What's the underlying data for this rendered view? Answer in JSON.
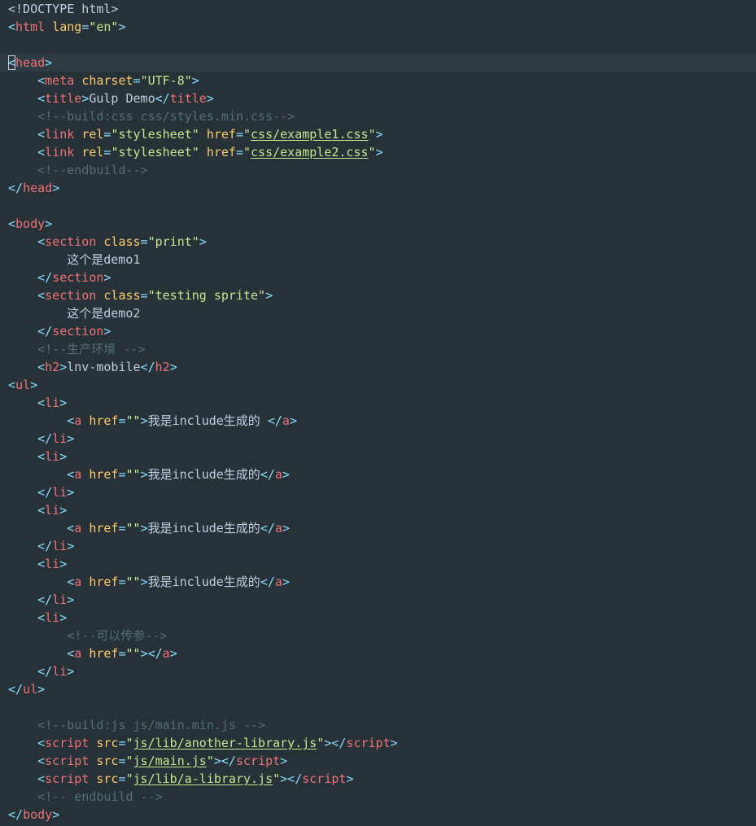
{
  "colors": {
    "background": "#263238",
    "current_line": "#2d3b42",
    "punct": "#89ddff",
    "plain": "#c3cee3",
    "tag": "#f07178",
    "attr": "#ffcb6b",
    "string": "#c3e88d",
    "comment": "#546e7a"
  },
  "editor": {
    "current_line_index": 3,
    "cursor_token": "<",
    "lines": [
      [
        [
          "plain",
          "<!DOCTYPE html>"
        ]
      ],
      [
        [
          "punct",
          "<"
        ],
        [
          "tag",
          "html"
        ],
        [
          "plain",
          " "
        ],
        [
          "attr",
          "lang"
        ],
        [
          "punct",
          "="
        ],
        [
          "str",
          "\"en\""
        ],
        [
          "punct",
          ">"
        ]
      ],
      [],
      [
        [
          "punct",
          "<"
        ],
        [
          "tag",
          "head"
        ],
        [
          "punct",
          ">"
        ]
      ],
      [
        [
          "plain",
          "    "
        ],
        [
          "punct",
          "<"
        ],
        [
          "tag",
          "meta"
        ],
        [
          "plain",
          " "
        ],
        [
          "attr",
          "charset"
        ],
        [
          "punct",
          "="
        ],
        [
          "str",
          "\"UTF-8\""
        ],
        [
          "punct",
          ">"
        ]
      ],
      [
        [
          "plain",
          "    "
        ],
        [
          "punct",
          "<"
        ],
        [
          "tag",
          "title"
        ],
        [
          "punct",
          ">"
        ],
        [
          "text",
          "Gulp Demo"
        ],
        [
          "punct",
          "</"
        ],
        [
          "tag",
          "title"
        ],
        [
          "punct",
          ">"
        ]
      ],
      [
        [
          "plain",
          "    "
        ],
        [
          "comment",
          "<!--build:css css/styles.min.css-->"
        ]
      ],
      [
        [
          "plain",
          "    "
        ],
        [
          "punct",
          "<"
        ],
        [
          "tag",
          "link"
        ],
        [
          "plain",
          " "
        ],
        [
          "attr",
          "rel"
        ],
        [
          "punct",
          "="
        ],
        [
          "str",
          "\"stylesheet\""
        ],
        [
          "plain",
          " "
        ],
        [
          "attr",
          "href"
        ],
        [
          "punct",
          "="
        ],
        [
          "str",
          "\""
        ],
        [
          "link",
          "css/example1.css"
        ],
        [
          "str",
          "\""
        ],
        [
          "punct",
          ">"
        ]
      ],
      [
        [
          "plain",
          "    "
        ],
        [
          "punct",
          "<"
        ],
        [
          "tag",
          "link"
        ],
        [
          "plain",
          " "
        ],
        [
          "attr",
          "rel"
        ],
        [
          "punct",
          "="
        ],
        [
          "str",
          "\"stylesheet\""
        ],
        [
          "plain",
          " "
        ],
        [
          "attr",
          "href"
        ],
        [
          "punct",
          "="
        ],
        [
          "str",
          "\""
        ],
        [
          "link",
          "css/example2.css"
        ],
        [
          "str",
          "\""
        ],
        [
          "punct",
          ">"
        ]
      ],
      [
        [
          "plain",
          "    "
        ],
        [
          "comment",
          "<!--endbuild-->"
        ]
      ],
      [
        [
          "punct",
          "</"
        ],
        [
          "tag",
          "head"
        ],
        [
          "punct",
          ">"
        ]
      ],
      [],
      [
        [
          "punct",
          "<"
        ],
        [
          "tag",
          "body"
        ],
        [
          "punct",
          ">"
        ]
      ],
      [
        [
          "plain",
          "    "
        ],
        [
          "punct",
          "<"
        ],
        [
          "tag",
          "section"
        ],
        [
          "plain",
          " "
        ],
        [
          "attr",
          "class"
        ],
        [
          "punct",
          "="
        ],
        [
          "str",
          "\"print\""
        ],
        [
          "punct",
          ">"
        ]
      ],
      [
        [
          "plain",
          "        "
        ],
        [
          "text",
          "这个是demo1"
        ]
      ],
      [
        [
          "plain",
          "    "
        ],
        [
          "punct",
          "</"
        ],
        [
          "tag",
          "section"
        ],
        [
          "punct",
          ">"
        ]
      ],
      [
        [
          "plain",
          "    "
        ],
        [
          "punct",
          "<"
        ],
        [
          "tag",
          "section"
        ],
        [
          "plain",
          " "
        ],
        [
          "attr",
          "class"
        ],
        [
          "punct",
          "="
        ],
        [
          "str",
          "\"testing sprite\""
        ],
        [
          "punct",
          ">"
        ]
      ],
      [
        [
          "plain",
          "        "
        ],
        [
          "text",
          "这个是demo2"
        ]
      ],
      [
        [
          "plain",
          "    "
        ],
        [
          "punct",
          "</"
        ],
        [
          "tag",
          "section"
        ],
        [
          "punct",
          ">"
        ]
      ],
      [
        [
          "plain",
          "    "
        ],
        [
          "comment",
          "<!--生产环境 -->"
        ]
      ],
      [
        [
          "plain",
          "    "
        ],
        [
          "punct",
          "<"
        ],
        [
          "tag",
          "h2"
        ],
        [
          "punct",
          ">"
        ],
        [
          "text",
          "lnv-mobile"
        ],
        [
          "punct",
          "</"
        ],
        [
          "tag",
          "h2"
        ],
        [
          "punct",
          ">"
        ]
      ],
      [
        [
          "punct",
          "<"
        ],
        [
          "tag",
          "ul"
        ],
        [
          "punct",
          ">"
        ]
      ],
      [
        [
          "plain",
          "    "
        ],
        [
          "punct",
          "<"
        ],
        [
          "tag",
          "li"
        ],
        [
          "punct",
          ">"
        ]
      ],
      [
        [
          "plain",
          "        "
        ],
        [
          "punct",
          "<"
        ],
        [
          "tag",
          "a"
        ],
        [
          "plain",
          " "
        ],
        [
          "attr",
          "href"
        ],
        [
          "punct",
          "="
        ],
        [
          "str",
          "\"\""
        ],
        [
          "punct",
          ">"
        ],
        [
          "text",
          "我是include生成的 "
        ],
        [
          "punct",
          "</"
        ],
        [
          "tag",
          "a"
        ],
        [
          "punct",
          ">"
        ]
      ],
      [
        [
          "plain",
          "    "
        ],
        [
          "punct",
          "</"
        ],
        [
          "tag",
          "li"
        ],
        [
          "punct",
          ">"
        ]
      ],
      [
        [
          "plain",
          "    "
        ],
        [
          "punct",
          "<"
        ],
        [
          "tag",
          "li"
        ],
        [
          "punct",
          ">"
        ]
      ],
      [
        [
          "plain",
          "        "
        ],
        [
          "punct",
          "<"
        ],
        [
          "tag",
          "a"
        ],
        [
          "plain",
          " "
        ],
        [
          "attr",
          "href"
        ],
        [
          "punct",
          "="
        ],
        [
          "str",
          "\"\""
        ],
        [
          "punct",
          ">"
        ],
        [
          "text",
          "我是include生成的"
        ],
        [
          "punct",
          "</"
        ],
        [
          "tag",
          "a"
        ],
        [
          "punct",
          ">"
        ]
      ],
      [
        [
          "plain",
          "    "
        ],
        [
          "punct",
          "</"
        ],
        [
          "tag",
          "li"
        ],
        [
          "punct",
          ">"
        ]
      ],
      [
        [
          "plain",
          "    "
        ],
        [
          "punct",
          "<"
        ],
        [
          "tag",
          "li"
        ],
        [
          "punct",
          ">"
        ]
      ],
      [
        [
          "plain",
          "        "
        ],
        [
          "punct",
          "<"
        ],
        [
          "tag",
          "a"
        ],
        [
          "plain",
          " "
        ],
        [
          "attr",
          "href"
        ],
        [
          "punct",
          "="
        ],
        [
          "str",
          "\"\""
        ],
        [
          "punct",
          ">"
        ],
        [
          "text",
          "我是include生成的"
        ],
        [
          "punct",
          "</"
        ],
        [
          "tag",
          "a"
        ],
        [
          "punct",
          ">"
        ]
      ],
      [
        [
          "plain",
          "    "
        ],
        [
          "punct",
          "</"
        ],
        [
          "tag",
          "li"
        ],
        [
          "punct",
          ">"
        ]
      ],
      [
        [
          "plain",
          "    "
        ],
        [
          "punct",
          "<"
        ],
        [
          "tag",
          "li"
        ],
        [
          "punct",
          ">"
        ]
      ],
      [
        [
          "plain",
          "        "
        ],
        [
          "punct",
          "<"
        ],
        [
          "tag",
          "a"
        ],
        [
          "plain",
          " "
        ],
        [
          "attr",
          "href"
        ],
        [
          "punct",
          "="
        ],
        [
          "str",
          "\"\""
        ],
        [
          "punct",
          ">"
        ],
        [
          "text",
          "我是include生成的"
        ],
        [
          "punct",
          "</"
        ],
        [
          "tag",
          "a"
        ],
        [
          "punct",
          ">"
        ]
      ],
      [
        [
          "plain",
          "    "
        ],
        [
          "punct",
          "</"
        ],
        [
          "tag",
          "li"
        ],
        [
          "punct",
          ">"
        ]
      ],
      [
        [
          "plain",
          "    "
        ],
        [
          "punct",
          "<"
        ],
        [
          "tag",
          "li"
        ],
        [
          "punct",
          ">"
        ]
      ],
      [
        [
          "plain",
          "        "
        ],
        [
          "comment",
          "<!--可以传参-->"
        ]
      ],
      [
        [
          "plain",
          "        "
        ],
        [
          "punct",
          "<"
        ],
        [
          "tag",
          "a"
        ],
        [
          "plain",
          " "
        ],
        [
          "attr",
          "href"
        ],
        [
          "punct",
          "="
        ],
        [
          "str",
          "\"\""
        ],
        [
          "punct",
          ">"
        ],
        [
          "punct",
          "</"
        ],
        [
          "tag",
          "a"
        ],
        [
          "punct",
          ">"
        ]
      ],
      [
        [
          "plain",
          "    "
        ],
        [
          "punct",
          "</"
        ],
        [
          "tag",
          "li"
        ],
        [
          "punct",
          ">"
        ]
      ],
      [
        [
          "punct",
          "</"
        ],
        [
          "tag",
          "ul"
        ],
        [
          "punct",
          ">"
        ]
      ],
      [],
      [
        [
          "plain",
          "    "
        ],
        [
          "comment",
          "<!--build:js js/main.min.js -->"
        ]
      ],
      [
        [
          "plain",
          "    "
        ],
        [
          "punct",
          "<"
        ],
        [
          "tag",
          "script"
        ],
        [
          "plain",
          " "
        ],
        [
          "attr",
          "src"
        ],
        [
          "punct",
          "="
        ],
        [
          "str",
          "\""
        ],
        [
          "link",
          "js/lib/another-library.js"
        ],
        [
          "str",
          "\""
        ],
        [
          "punct",
          "></"
        ],
        [
          "tag",
          "script"
        ],
        [
          "punct",
          ">"
        ]
      ],
      [
        [
          "plain",
          "    "
        ],
        [
          "punct",
          "<"
        ],
        [
          "tag",
          "script"
        ],
        [
          "plain",
          " "
        ],
        [
          "attr",
          "src"
        ],
        [
          "punct",
          "="
        ],
        [
          "str",
          "\""
        ],
        [
          "link",
          "js/main.js"
        ],
        [
          "str",
          "\""
        ],
        [
          "punct",
          "></"
        ],
        [
          "tag",
          "script"
        ],
        [
          "punct",
          ">"
        ]
      ],
      [
        [
          "plain",
          "    "
        ],
        [
          "punct",
          "<"
        ],
        [
          "tag",
          "script"
        ],
        [
          "plain",
          " "
        ],
        [
          "attr",
          "src"
        ],
        [
          "punct",
          "="
        ],
        [
          "str",
          "\""
        ],
        [
          "link",
          "js/lib/a-library.js"
        ],
        [
          "str",
          "\""
        ],
        [
          "punct",
          "></"
        ],
        [
          "tag",
          "script"
        ],
        [
          "punct",
          ">"
        ]
      ],
      [
        [
          "plain",
          "    "
        ],
        [
          "comment",
          "<!-- endbuild -->"
        ]
      ],
      [
        [
          "punct",
          "</"
        ],
        [
          "tag",
          "body"
        ],
        [
          "punct",
          ">"
        ]
      ]
    ]
  }
}
